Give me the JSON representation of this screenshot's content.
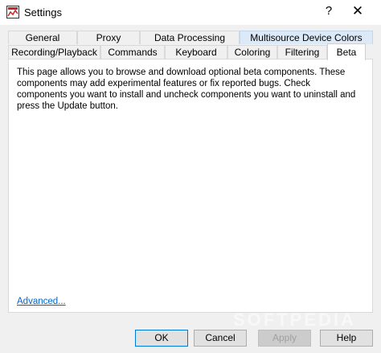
{
  "window": {
    "title": "Settings",
    "help_symbol": "?",
    "close_symbol": "✕"
  },
  "tabs": {
    "back_row": [
      {
        "label": "General"
      },
      {
        "label": "Proxy"
      },
      {
        "label": "Data Processing"
      },
      {
        "label": "Multisource Device Colors"
      }
    ],
    "front_row": [
      {
        "label": "Recording/Playback"
      },
      {
        "label": "Commands"
      },
      {
        "label": "Keyboard"
      },
      {
        "label": "Coloring"
      },
      {
        "label": "Filtering"
      },
      {
        "label": "Beta"
      }
    ]
  },
  "panel": {
    "description": "This page allows you to browse and download optional beta components. These components may add experimental features or fix reported bugs. Check components you want to install and uncheck components you want to uninstall and press the Update button.",
    "advanced_link": "Advanced..."
  },
  "buttons": {
    "ok": "OK",
    "cancel": "Cancel",
    "apply": "Apply",
    "help": "Help"
  },
  "watermark": "SOFTPEDIA",
  "colors": {
    "link": "#0066cc",
    "default_button_border": "#0078d7",
    "highlight_tab": "#dce9f7"
  }
}
